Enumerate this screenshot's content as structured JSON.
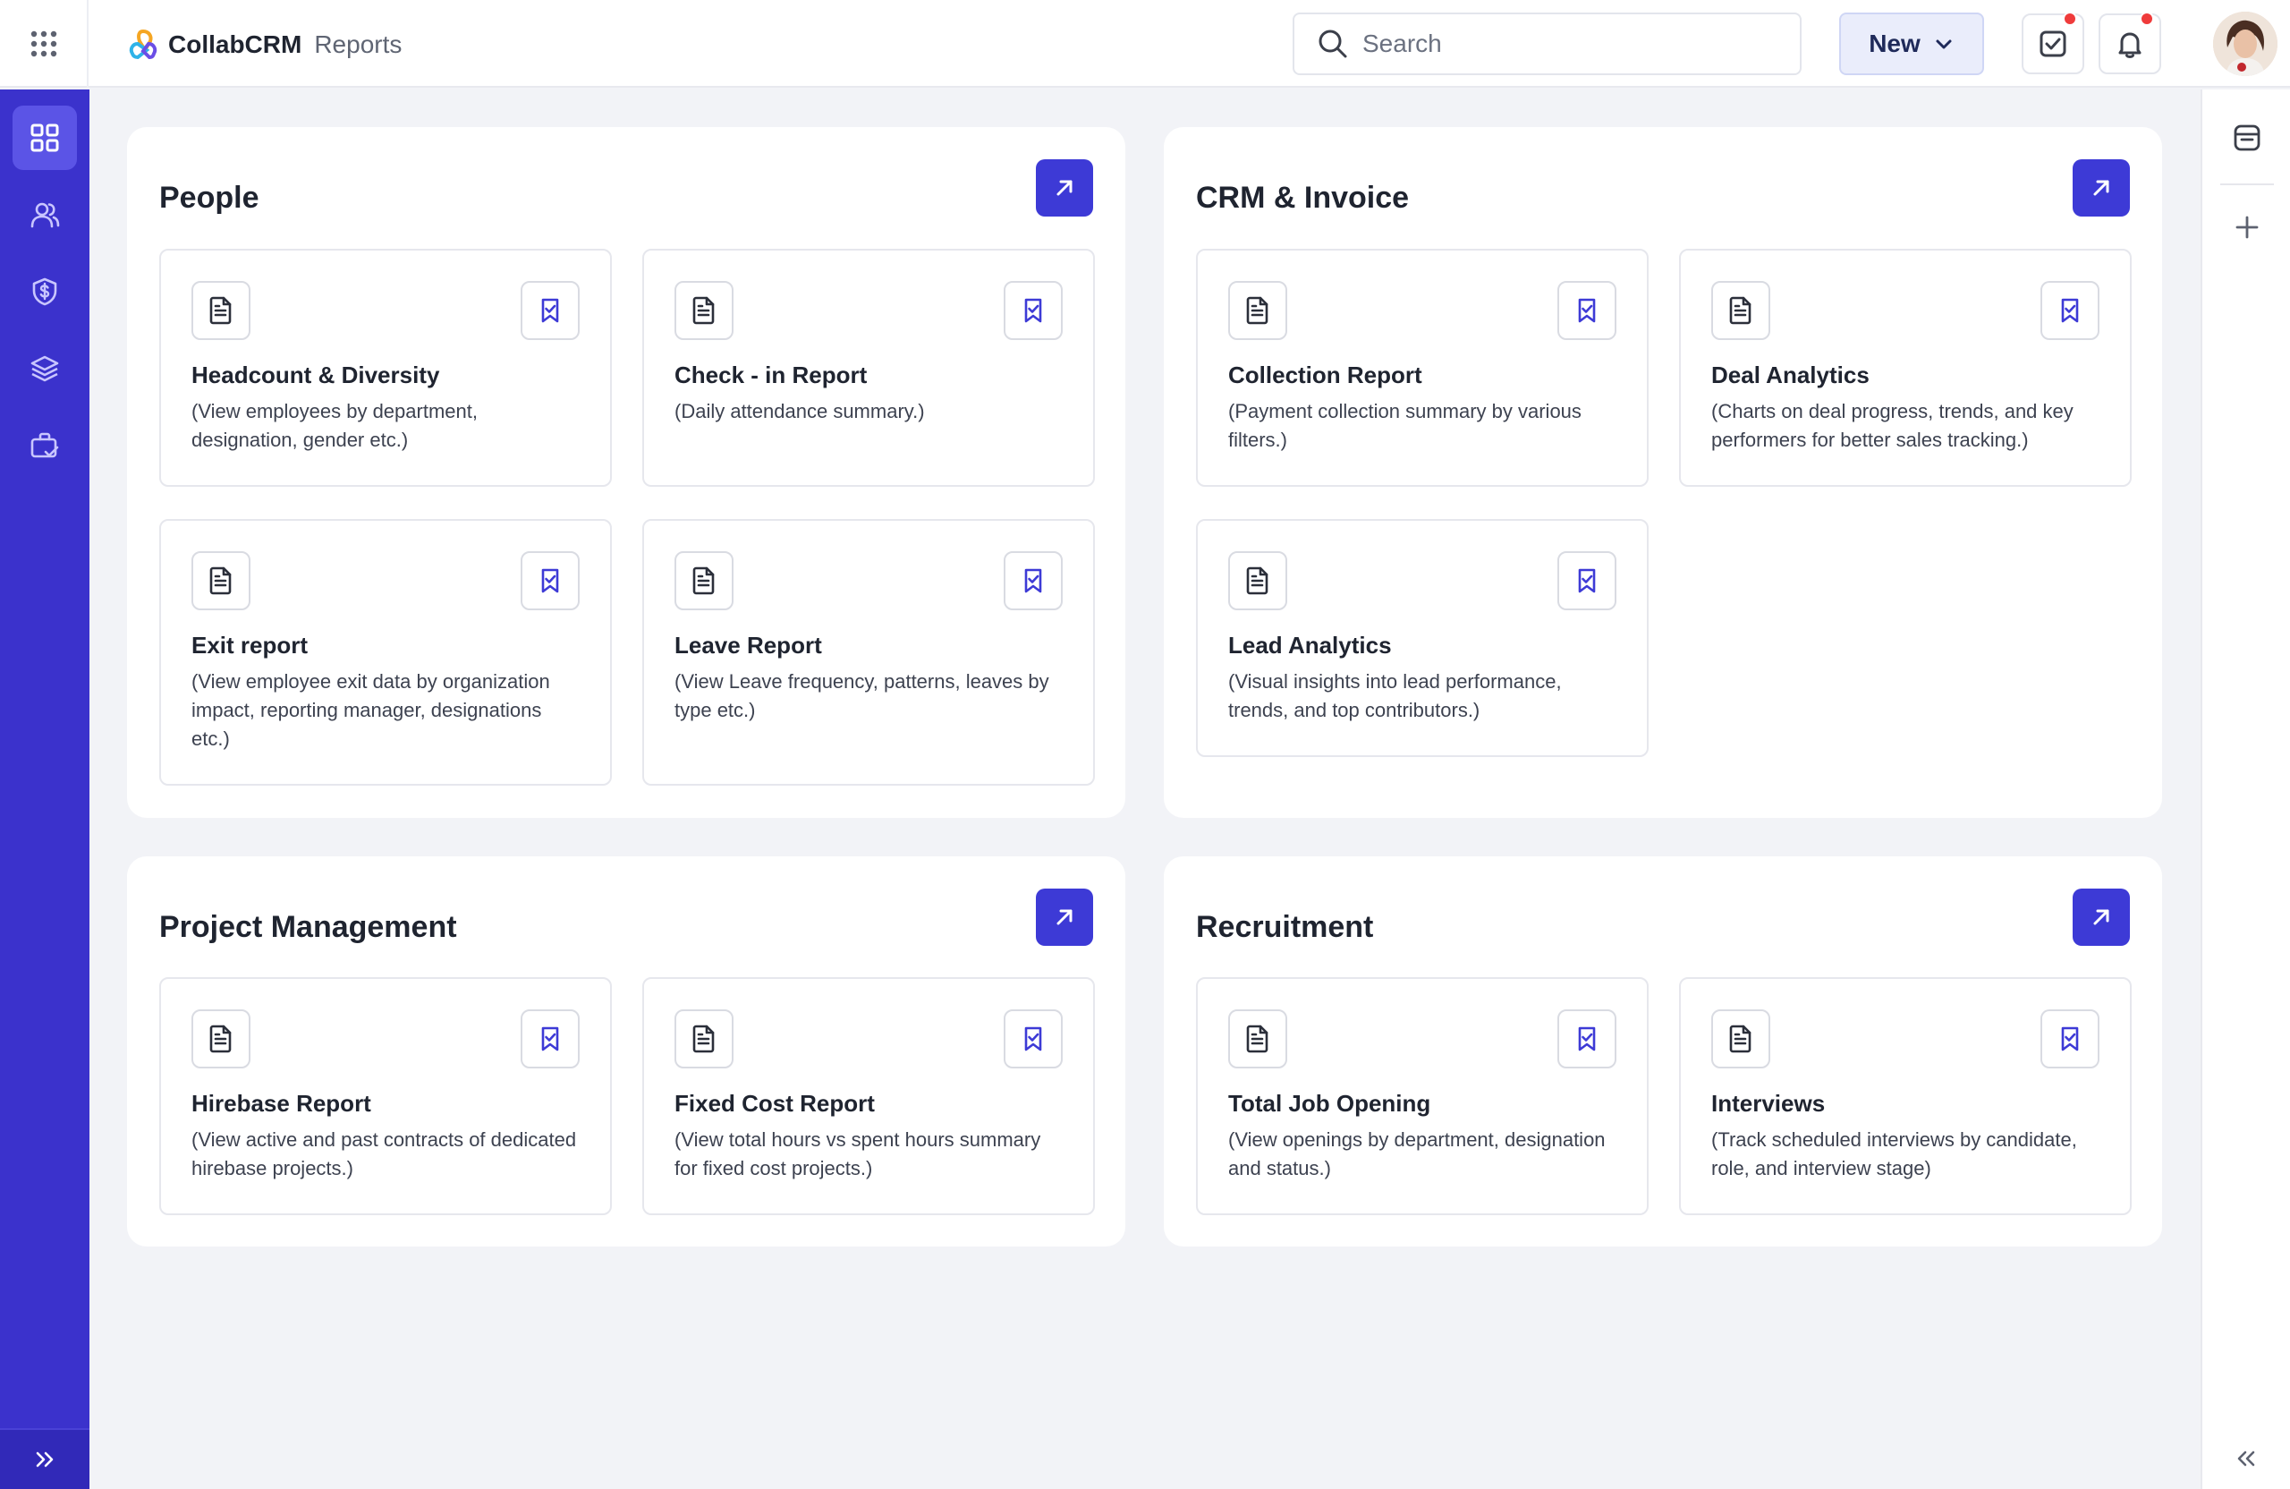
{
  "header": {
    "brand_name": "CollabCRM",
    "brand_sub": "Reports",
    "search_placeholder": "Search",
    "new_label": "New"
  },
  "sidebar": {
    "items": [
      {
        "icon": "dashboard-grid-icon",
        "active": true
      },
      {
        "icon": "users-icon"
      },
      {
        "icon": "shield-dollar-icon"
      },
      {
        "icon": "layers-icon"
      },
      {
        "icon": "briefcase-check-icon"
      }
    ]
  },
  "colors": {
    "sidebar": "#3b32cc",
    "accent": "#3d3ad6",
    "notification": "#ef3b3b"
  },
  "sections": [
    {
      "title": "People",
      "cards": [
        {
          "title": "Headcount & Diversity",
          "desc": "(View employees by department, designation, gender etc.)"
        },
        {
          "title": "Check - in Report",
          "desc": "(Daily attendance summary.)"
        },
        {
          "title": "Exit report",
          "desc": "(View employee exit data by organization impact, reporting manager, designations etc.)"
        },
        {
          "title": "Leave Report",
          "desc": "(View Leave frequency, patterns, leaves by type etc.)"
        }
      ]
    },
    {
      "title": "CRM & Invoice",
      "cards": [
        {
          "title": "Collection Report",
          "desc": "(Payment collection summary by various filters.)"
        },
        {
          "title": "Deal Analytics",
          "desc": "(Charts on deal progress, trends, and key performers for better sales tracking.)"
        },
        {
          "title": "Lead Analytics",
          "desc": "(Visual insights into lead performance, trends, and top contributors.)"
        }
      ]
    },
    {
      "title": "Project Management",
      "cards": [
        {
          "title": "Hirebase Report",
          "desc": "(View active and past contracts of dedicated hirebase projects.)"
        },
        {
          "title": "Fixed Cost Report",
          "desc": "(View total hours vs spent hours summary for fixed cost projects.)"
        }
      ]
    },
    {
      "title": "Recruitment",
      "cards": [
        {
          "title": "Total Job Opening",
          "desc": "(View openings by department, designation and status.)"
        },
        {
          "title": "Interviews",
          "desc": "(Track scheduled interviews by candidate, role, and interview stage)"
        }
      ]
    }
  ]
}
